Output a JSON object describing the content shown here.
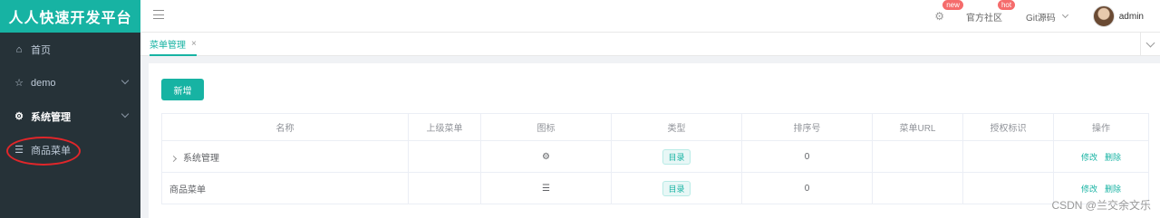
{
  "app_title": "人人快速开发平台",
  "sidebar": {
    "items": [
      {
        "icon": "home-icon",
        "glyph": "⌂",
        "label": "首页"
      },
      {
        "icon": "star-icon",
        "glyph": "☆",
        "label": "demo"
      },
      {
        "icon": "gear-icon",
        "glyph": "⚙",
        "label": "系统管理"
      },
      {
        "icon": "menu-icon",
        "glyph": "☰",
        "label": "商品菜单"
      }
    ]
  },
  "header": {
    "badge_new": "new",
    "community": "官方社区",
    "badge_hot": "hot",
    "git": "Git源码",
    "user": "admin"
  },
  "tabs": [
    {
      "label": "菜单管理",
      "close": "×"
    }
  ],
  "toolbar": {
    "add_label": "新增"
  },
  "table": {
    "headers": [
      "名称",
      "上级菜单",
      "图标",
      "类型",
      "排序号",
      "菜单URL",
      "授权标识",
      "操作"
    ],
    "rows": [
      {
        "name": "系统管理",
        "parent": "",
        "icon": "⚙",
        "type": "目录",
        "order": "0",
        "url": "",
        "perm": "",
        "edit": "修改",
        "delete": "删除"
      },
      {
        "name": "商品菜单",
        "parent": "",
        "icon": "☰",
        "type": "目录",
        "order": "0",
        "url": "",
        "perm": "",
        "edit": "修改",
        "delete": "删除"
      }
    ]
  },
  "watermark": "CSDN @兰交余文乐",
  "colors": {
    "accent": "#17b3a3",
    "sidebar_bg": "#263238",
    "badge": "#f56c6c",
    "highlight_oval": "#e0262a"
  }
}
